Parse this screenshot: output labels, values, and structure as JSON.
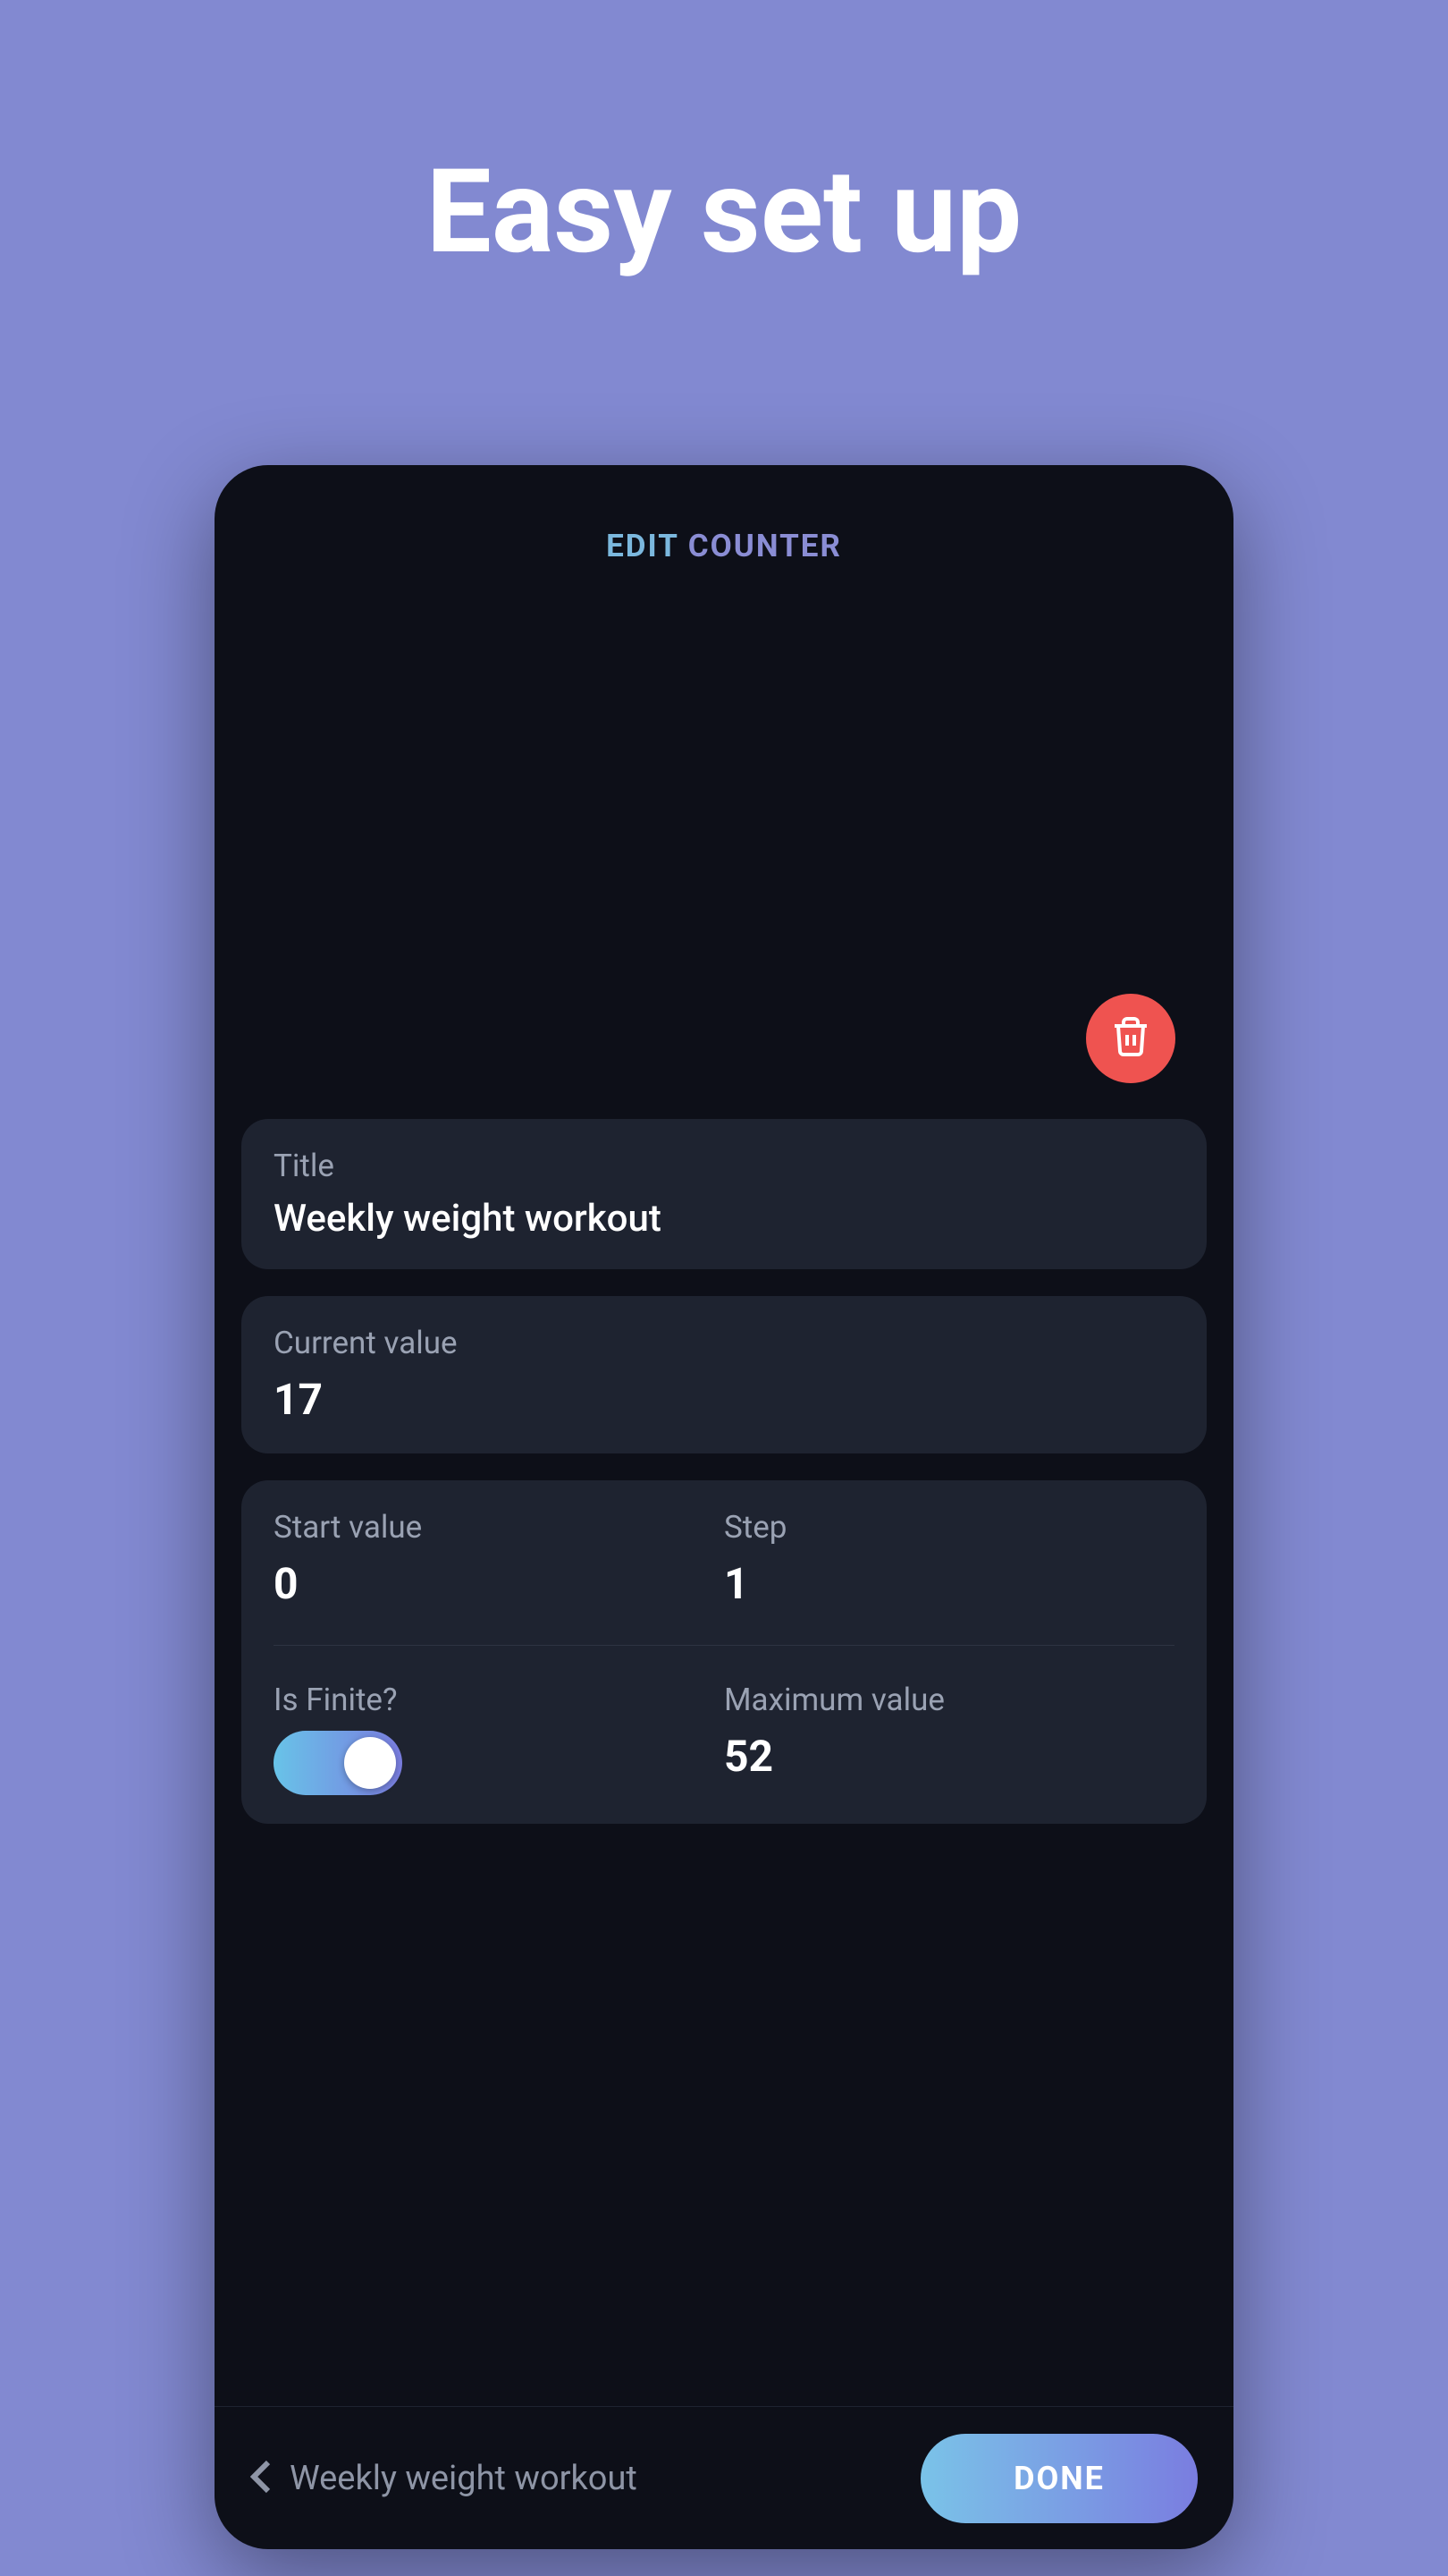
{
  "page_heading": "Easy set up",
  "header": {
    "title_part1": "EDIT",
    "title_part2": "COUNTER"
  },
  "form": {
    "title_label": "Title",
    "title_value": "Weekly weight workout",
    "current_value_label": "Current value",
    "current_value": "17",
    "start_value_label": "Start value",
    "start_value": "0",
    "step_label": "Step",
    "step_value": "1",
    "is_finite_label": "Is Finite?",
    "is_finite": true,
    "maximum_value_label": "Maximum value",
    "maximum_value": "52"
  },
  "footer": {
    "back_text": "Weekly weight workout",
    "done_label": "DONE"
  },
  "colors": {
    "background": "#8289d1",
    "card": "#1e2330",
    "phone_bg": "#0d0f18",
    "accent_start": "#7ac3e8",
    "accent_end": "#7a7de0",
    "danger": "#ef5350"
  }
}
